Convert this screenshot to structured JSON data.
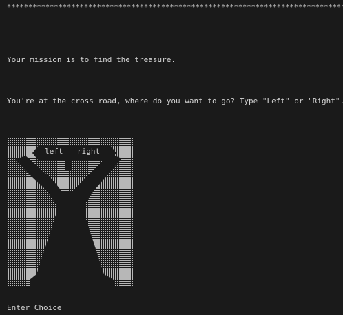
{
  "terminal": {
    "divider": "*********************************************************************************",
    "mission": "Your mission is to find the treasure.",
    "question": "You're at the cross road, where do you want to go? Type \"Left\" or \"Right\".",
    "prompt": "Enter Choice"
  },
  "art": {
    "sign_left": "left",
    "sign_right": "right"
  },
  "colors": {
    "background": "#1a1a1a",
    "text": "#d4d4d4",
    "dots": "#cfcfcf"
  }
}
